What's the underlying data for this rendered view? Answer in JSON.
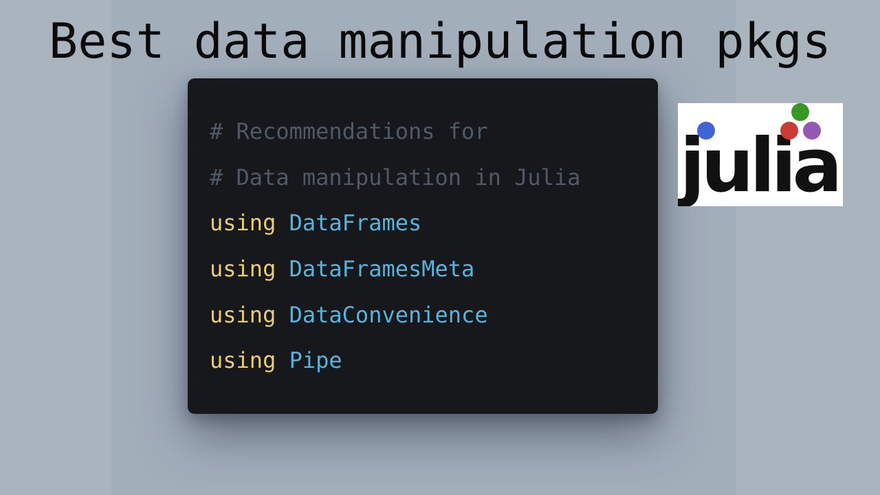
{
  "title": "Best data manipulation pkgs",
  "code": {
    "lines": [
      {
        "kind": "comment",
        "text": "# Recommendations for"
      },
      {
        "kind": "comment",
        "text": "# Data manipulation in Julia"
      },
      {
        "kind": "using",
        "keyword": "using",
        "module": "DataFrames"
      },
      {
        "kind": "using",
        "keyword": "using",
        "module": "DataFramesMeta"
      },
      {
        "kind": "using",
        "keyword": "using",
        "module": "DataConvenience"
      },
      {
        "kind": "using",
        "keyword": "using",
        "module": "Pipe"
      }
    ]
  },
  "logo": {
    "text": "julia",
    "dot_colors": {
      "blue": "#4063d8",
      "green": "#389826",
      "red": "#cb3c33",
      "purple": "#9558b2"
    }
  },
  "colors": {
    "background": "#a9b4bf",
    "card": "#16181c",
    "comment": "#4f5a66",
    "keyword": "#e7cd79",
    "module": "#56b3dc"
  }
}
